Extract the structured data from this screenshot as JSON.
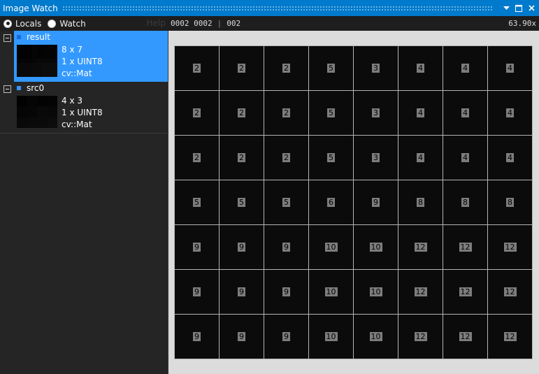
{
  "window": {
    "title": "Image Watch",
    "buttons": [
      {
        "name": "dropdown-icon",
        "glyph": "▼"
      },
      {
        "name": "maximize-icon",
        "glyph": "■"
      },
      {
        "name": "close-icon",
        "glyph": "✕"
      }
    ]
  },
  "toolbar": {
    "radios": [
      {
        "label": "Locals",
        "checked": true
      },
      {
        "label": "Watch",
        "checked": false
      }
    ],
    "help_label": "Help",
    "coords": "0002 0002",
    "pixel_value": "002",
    "zoom": "63.90x"
  },
  "variables": [
    {
      "name": "result",
      "size": "8 x 7",
      "type": "1 x UINT8",
      "class": "cv::Mat",
      "selected": true
    },
    {
      "name": "src0",
      "size": "4 x 3",
      "type": "1 x UINT8",
      "class": "cv::Mat",
      "selected": false
    }
  ],
  "pixels": {
    "cols": 8,
    "rows": 7,
    "values": [
      [
        2,
        2,
        2,
        5,
        3,
        4,
        4,
        4
      ],
      [
        2,
        2,
        2,
        5,
        3,
        4,
        4,
        4
      ],
      [
        2,
        2,
        2,
        5,
        3,
        4,
        4,
        4
      ],
      [
        5,
        5,
        5,
        6,
        9,
        8,
        8,
        8
      ],
      [
        9,
        9,
        9,
        10,
        10,
        12,
        12,
        12
      ],
      [
        9,
        9,
        9,
        10,
        10,
        12,
        12,
        12
      ],
      [
        9,
        9,
        9,
        10,
        10,
        12,
        12,
        12
      ]
    ]
  },
  "thumbnails": {
    "src0": [
      [
        2,
        5,
        3,
        4
      ],
      [
        5,
        6,
        9,
        8
      ],
      [
        9,
        10,
        10,
        12
      ]
    ]
  },
  "colors": {
    "accent": "#007acc",
    "selection": "#3399ff"
  }
}
